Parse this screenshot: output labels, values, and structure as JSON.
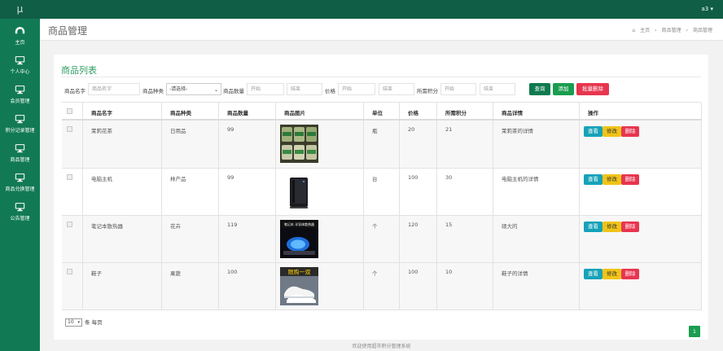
{
  "app": {
    "logo": "μ",
    "user": "a3 ▾"
  },
  "sidebar": {
    "items": [
      {
        "label": "主页",
        "icon": "dashboard-icon"
      },
      {
        "label": "个人中心",
        "icon": "monitor-icon"
      },
      {
        "label": "会员管理",
        "icon": "monitor-icon"
      },
      {
        "label": "积分记录管理",
        "icon": "monitor-icon"
      },
      {
        "label": "商品管理",
        "icon": "monitor-icon"
      },
      {
        "label": "商品兑换管理",
        "icon": "monitor-icon"
      },
      {
        "label": "公告管理",
        "icon": "monitor-icon"
      }
    ]
  },
  "header": {
    "title": "商品管理",
    "breadcrumb": [
      "主页",
      "商品管理",
      "商品管理"
    ]
  },
  "panel": {
    "title": "商品列表"
  },
  "search": {
    "name_label": "商品名字",
    "name_placeholder": "商品名字",
    "type_label": "商品种类",
    "type_selected": "-请选择-",
    "qty_label": "商品数量",
    "qty_start": "开始",
    "qty_end": "结束",
    "price_label": "价格",
    "price_start": "开始",
    "price_end": "结束",
    "points_label": "所需积分",
    "points_start": "开始",
    "points_end": "结束",
    "query": "查询",
    "add": "添加",
    "batch_delete": "批量删除"
  },
  "table": {
    "headers": [
      "商品名字",
      "商品种类",
      "商品数量",
      "商品图片",
      "单位",
      "价格",
      "所需积分",
      "商品详情",
      "操作"
    ],
    "actions": {
      "view": "查看",
      "edit": "修改",
      "delete": "删除"
    },
    "rows": [
      {
        "name": "茉莉花茶",
        "type": "日用品",
        "qty": "99",
        "unit": "瓶",
        "price": "20",
        "points": "21",
        "detail": "茉莉茶的详情",
        "image": "tea-jars"
      },
      {
        "name": "电脑主机",
        "type": "林产品",
        "qty": "99",
        "unit": "台",
        "price": "100",
        "points": "30",
        "detail": "电脑主机的详情",
        "image": "pc-tower"
      },
      {
        "name": "笔记本散热器",
        "type": "花卉",
        "qty": "119",
        "unit": "个",
        "price": "120",
        "points": "15",
        "detail": "硕大的",
        "image": "laptop-cooler"
      },
      {
        "name": "鞋子",
        "type": "果蔬",
        "qty": "100",
        "unit": "个",
        "price": "100",
        "points": "10",
        "detail": "鞋子的详情",
        "image": "white-shoes"
      }
    ]
  },
  "thumb_text": {
    "cooler_banner": "笔记本  半导体散热器",
    "shoes_banner": "限购一双"
  },
  "pager": {
    "page_size": "10",
    "per_page_label": "条 每页",
    "current_page": "1"
  },
  "footer": {
    "text": "欢迎使用超市积分管理系统"
  },
  "colors": {
    "topbar": "#0f5e45",
    "sidebar": "#117a55",
    "accent": "#2f9e63",
    "danger": "#e8354f",
    "info": "#17a2b8",
    "warning": "#f0c419"
  }
}
